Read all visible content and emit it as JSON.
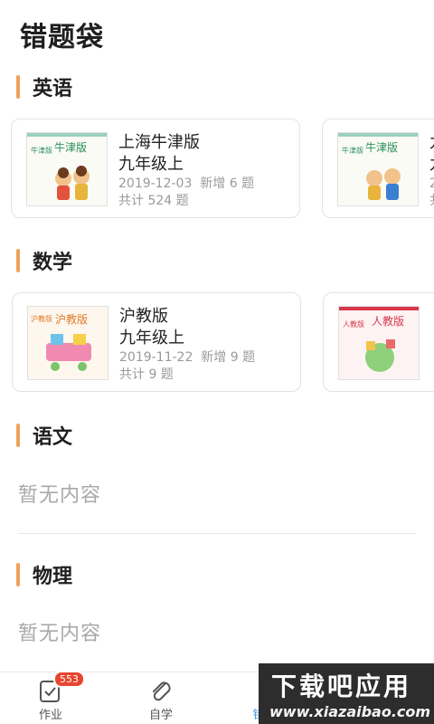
{
  "page": {
    "title": "错题袋"
  },
  "sections": {
    "english": {
      "label": "英语",
      "cards": [
        {
          "cover_title": "牛津版",
          "cover_side": "牛津版",
          "publisher": "上海牛津版",
          "grade": "九年级上",
          "date": "2019-12-03",
          "new_text": "新增 6 题",
          "total_text": "共计 524 题"
        },
        {
          "cover_title": "牛津版",
          "cover_side": "牛津版",
          "publisher": "九",
          "grade": "九",
          "date": "2",
          "new_text": "",
          "total_text": "共"
        }
      ]
    },
    "math": {
      "label": "数学",
      "cards": [
        {
          "cover_title": "沪教版",
          "cover_side": "沪教版",
          "publisher": "沪教版",
          "grade": "九年级上",
          "date": "2019-11-22",
          "new_text": "新增 9 题",
          "total_text": "共计 9 题"
        },
        {
          "cover_title": "人教版",
          "cover_side": "人教版",
          "publisher": "",
          "grade": "",
          "date": "",
          "new_text": "",
          "total_text": ""
        }
      ]
    },
    "chinese": {
      "label": "语文",
      "empty_text": "暂无内容"
    },
    "physics": {
      "label": "物理",
      "empty_text": "暂无内容"
    }
  },
  "tabbar": {
    "homework": {
      "label": "作业",
      "badge": "553"
    },
    "self_study": {
      "label": "自学"
    },
    "wrong_questions": {
      "label": "错"
    }
  },
  "watermark": {
    "main": "下载吧应用",
    "url": "www.xiazaibao.com"
  },
  "colors": {
    "accent": "#f0a15a",
    "badge": "#e7452f",
    "muted": "#a9a9a9",
    "active_tab": "#3a8ee6"
  }
}
